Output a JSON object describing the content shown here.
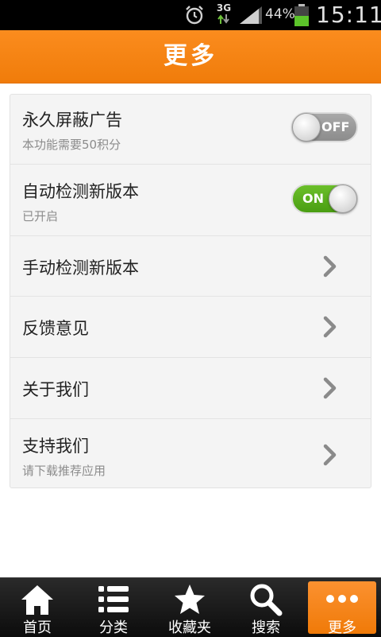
{
  "status_bar": {
    "network": "3G",
    "battery_percent": "44%",
    "time": "15:11",
    "icons": [
      "alarm-icon",
      "network-3g-icon",
      "signal-icon",
      "battery-icon"
    ]
  },
  "header": {
    "title": "更多"
  },
  "settings": {
    "rows": [
      {
        "title": "永久屏蔽广告",
        "subtitle": "本功能需要50积分",
        "toggle": "OFF"
      },
      {
        "title": "自动检测新版本",
        "subtitle": "已开启",
        "toggle": "ON"
      },
      {
        "title": "手动检测新版本"
      },
      {
        "title": "反馈意见"
      },
      {
        "title": "关于我们"
      },
      {
        "title": "支持我们",
        "subtitle": "请下载推荐应用"
      }
    ]
  },
  "bottom_nav": {
    "items": [
      {
        "label": "首页",
        "icon": "home-icon"
      },
      {
        "label": "分类",
        "icon": "list-icon"
      },
      {
        "label": "收藏夹",
        "icon": "star-icon"
      },
      {
        "label": "搜索",
        "icon": "search-icon"
      },
      {
        "label": "更多",
        "icon": "more-icon",
        "active": true
      }
    ]
  },
  "colors": {
    "accent": "#f58216",
    "toggle_on": "#5aad1d",
    "toggle_off": "#999999"
  }
}
